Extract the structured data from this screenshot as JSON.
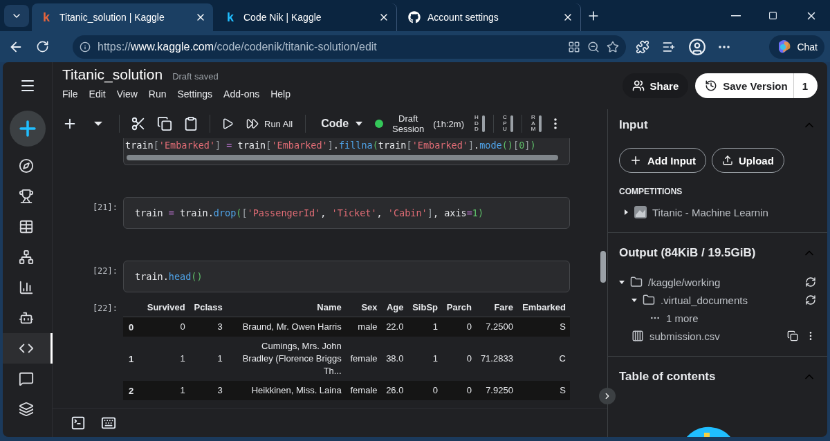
{
  "browser": {
    "tabs": [
      {
        "title": "Titanic_solution | Kaggle",
        "selected": true,
        "favicon": {
          "kind": "letter",
          "glyph": "k",
          "color": "#e8643c"
        }
      },
      {
        "title": "Code Nik | Kaggle",
        "selected": false,
        "favicon": {
          "kind": "letter",
          "glyph": "k",
          "color": "#20beff"
        }
      },
      {
        "title": "Account settings",
        "selected": false,
        "favicon": {
          "kind": "github"
        }
      }
    ],
    "url": {
      "scheme": "https://",
      "host": "www.kaggle.com",
      "path": "/code/codenik/titanic-solution/edit"
    },
    "chat": "Chat"
  },
  "rail": [
    {
      "kind": "compass",
      "selected": false
    },
    {
      "kind": "trophy",
      "selected": false
    },
    {
      "kind": "table",
      "selected": false
    },
    {
      "kind": "network",
      "selected": false
    },
    {
      "kind": "chart",
      "selected": false
    },
    {
      "kind": "robot",
      "selected": false
    },
    {
      "kind": "code",
      "selected": true
    },
    {
      "kind": "comment",
      "selected": false
    },
    {
      "kind": "learn",
      "selected": false
    }
  ],
  "notebook": {
    "title": "Titanic_solution",
    "status": "Draft saved",
    "menu": [
      "File",
      "Edit",
      "View",
      "Run",
      "Settings",
      "Add-ons",
      "Help"
    ]
  },
  "toolbar": {
    "run_all": "Run All",
    "cell_type": "Code",
    "session": {
      "active": true,
      "label": "Draft Session",
      "time": "(1h:2m)"
    },
    "meters": [
      {
        "label": "HDD",
        "level": 1
      },
      {
        "label": "CPU",
        "level": 1
      },
      {
        "label": "RAM",
        "level": 1
      }
    ]
  },
  "actions": {
    "share": "Share",
    "save": "Save Version",
    "versions": "1"
  },
  "cells": [
    {
      "scrollbar": true,
      "tokens": [
        {
          "kind": "name",
          "text": "train"
        },
        {
          "kind": "bracket",
          "text": "["
        },
        {
          "kind": "string",
          "text": "'Embarked'"
        },
        {
          "kind": "bracket",
          "text": "]"
        },
        {
          "kind": "op",
          "text": " = "
        },
        {
          "kind": "name",
          "text": "train"
        },
        {
          "kind": "bracket",
          "text": "["
        },
        {
          "kind": "string",
          "text": "'Embarked'"
        },
        {
          "kind": "bracket",
          "text": "]"
        },
        {
          "kind": "name",
          "text": "."
        },
        {
          "kind": "attr",
          "text": "fillna"
        },
        {
          "kind": "paren",
          "text": "("
        },
        {
          "kind": "name",
          "text": "train"
        },
        {
          "kind": "bracket",
          "text": "["
        },
        {
          "kind": "string",
          "text": "'Embarked'"
        },
        {
          "kind": "bracket",
          "text": "]"
        },
        {
          "kind": "name",
          "text": "."
        },
        {
          "kind": "attr",
          "text": "mode"
        },
        {
          "kind": "paren",
          "text": "()"
        },
        {
          "kind": "bracket",
          "text": "["
        },
        {
          "kind": "number",
          "text": "0"
        },
        {
          "kind": "bracket",
          "text": "]"
        },
        {
          "kind": "paren",
          "text": ")"
        }
      ]
    },
    {
      "prompt": "[21]:",
      "tokens": [
        {
          "kind": "name",
          "text": "train"
        },
        {
          "kind": "op",
          "text": " = "
        },
        {
          "kind": "name",
          "text": "train."
        },
        {
          "kind": "attr",
          "text": "drop"
        },
        {
          "kind": "paren",
          "text": "("
        },
        {
          "kind": "bracket",
          "text": "["
        },
        {
          "kind": "string",
          "text": "'PassengerId'"
        },
        {
          "kind": "name",
          "text": ", "
        },
        {
          "kind": "string",
          "text": "'Ticket'"
        },
        {
          "kind": "name",
          "text": ", "
        },
        {
          "kind": "string",
          "text": "'Cabin'"
        },
        {
          "kind": "bracket",
          "text": "]"
        },
        {
          "kind": "name",
          "text": ", axis"
        },
        {
          "kind": "op",
          "text": "="
        },
        {
          "kind": "number",
          "text": "1"
        },
        {
          "kind": "paren",
          "text": ")"
        }
      ]
    },
    {
      "prompt": "[22]:",
      "tokens": [
        {
          "kind": "name",
          "text": "train."
        },
        {
          "kind": "attr",
          "text": "head"
        },
        {
          "kind": "paren",
          "text": "()"
        }
      ]
    }
  ],
  "output": {
    "prompt": "[22]:",
    "columns": [
      "Survived",
      "Pclass",
      "Name",
      "Sex",
      "Age",
      "SibSp",
      "Parch",
      "Fare",
      "Embarked"
    ],
    "rows": [
      {
        "index": "0",
        "cells": [
          "0",
          "3",
          "Braund, Mr. Owen Harris",
          "male",
          "22.0",
          "1",
          "0",
          "7.2500",
          "S"
        ]
      },
      {
        "index": "1",
        "cells": [
          "1",
          "1",
          "Cumings, Mrs. John Bradley (Florence Briggs Th...",
          "female",
          "38.0",
          "1",
          "0",
          "71.2833",
          "C"
        ]
      },
      {
        "index": "2",
        "cells": [
          "1",
          "3",
          "Heikkinen, Miss. Laina",
          "female",
          "26.0",
          "0",
          "0",
          "7.9250",
          "S"
        ]
      }
    ]
  },
  "panel": {
    "input": {
      "title": "Input",
      "expanded": true,
      "buttons": [
        "Add Input",
        "Upload"
      ],
      "group": "COMPETITIONS",
      "items": [
        {
          "label": "Titanic - Machine Learnin",
          "expanded": false
        }
      ]
    },
    "output": {
      "title": "Output (84KiB / 19.5GiB)",
      "expanded": true,
      "tree": [
        {
          "kind": "folder",
          "label": "/kaggle/working",
          "expanded": true,
          "children": [
            {
              "kind": "folder",
              "label": ".virtual_documents",
              "expanded": true,
              "children": [
                {
                  "kind": "more",
                  "label": "1 more"
                }
              ]
            },
            {
              "kind": "file",
              "label": "submission.csv"
            }
          ]
        }
      ]
    },
    "toc": {
      "title": "Table of contents",
      "expanded": true
    }
  }
}
